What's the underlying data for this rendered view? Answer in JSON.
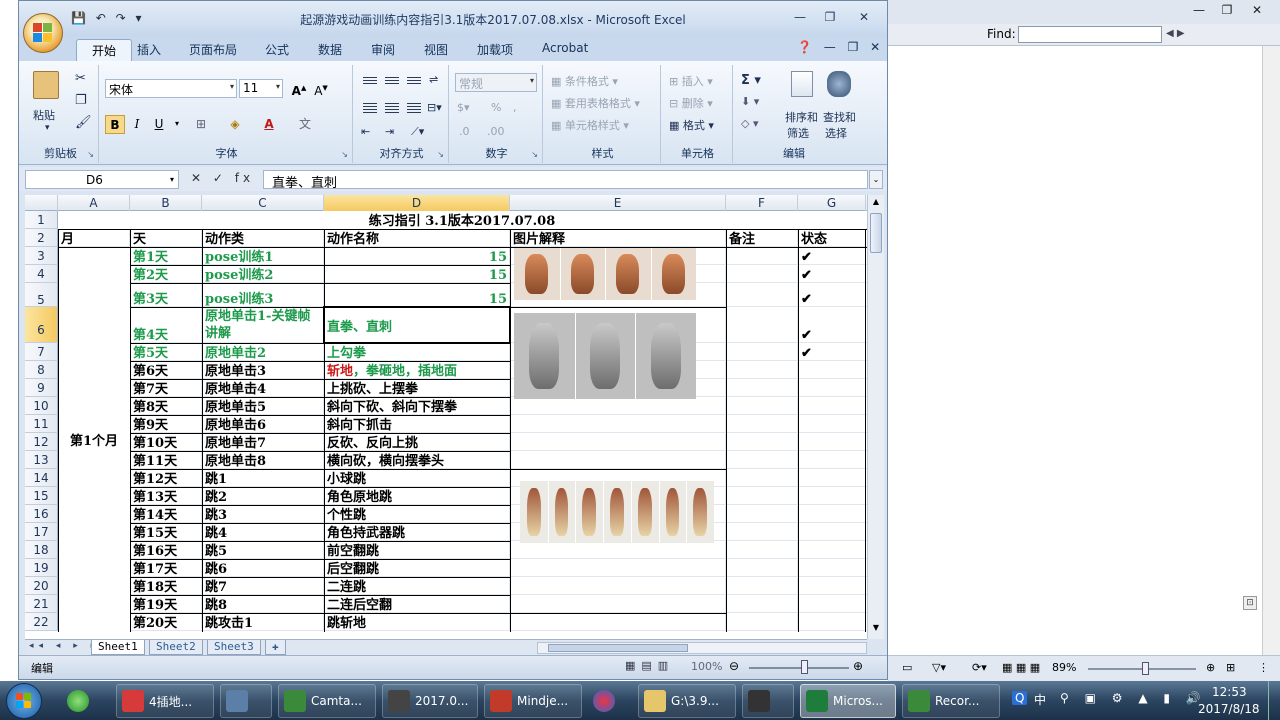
{
  "background_window": {
    "find_label": "Find:",
    "zoom": "89%",
    "window_controls": [
      "—",
      "❐",
      "✕"
    ]
  },
  "title_bar": {
    "title": "起源游戏动画训练内容指引3.1版本2017.07.08.xlsx - Microsoft Excel",
    "quick_access": "💾 ↶ ↷ ▾",
    "controls": [
      "—",
      "❐",
      "✕"
    ]
  },
  "tabs": [
    "开始",
    "插入",
    "页面布局",
    "公式",
    "数据",
    "审阅",
    "视图",
    "加载项",
    "Acrobat"
  ],
  "tabs_right": "❓ — ❐ ✕",
  "ribbon": {
    "clipboard": {
      "label": "剪贴板",
      "paste": "粘贴"
    },
    "font": {
      "label": "字体",
      "name": "宋体",
      "size": "11"
    },
    "alignment": {
      "label": "对齐方式"
    },
    "number": {
      "label": "数字",
      "format": "常规"
    },
    "styles": {
      "label": "样式",
      "conditional": "条件格式",
      "table": "套用表格格式",
      "cell": "单元格样式"
    },
    "cells": {
      "label": "单元格",
      "insert": "插入",
      "delete": "删除",
      "format": "格式"
    },
    "editing": {
      "label": "编辑",
      "sort": "排序和",
      "sort2": "筛选",
      "find": "查找和",
      "find2": "选择"
    }
  },
  "formula_bar": {
    "name_box": "D6",
    "fx": "✕ ✓ fx",
    "content": "直拳、直刺"
  },
  "columns": [
    "A",
    "B",
    "C",
    "D",
    "E",
    "F",
    "G"
  ],
  "rows": [
    "1",
    "2",
    "3",
    "4",
    "5",
    "6",
    "7",
    "8",
    "9",
    "10",
    "11",
    "12",
    "13",
    "14",
    "15",
    "16",
    "17",
    "18",
    "19",
    "20",
    "21",
    "22"
  ],
  "sheet": {
    "title": "练习指引 3.1版本2017.07.08",
    "headers": [
      "月",
      "天",
      "动作类",
      "动作名称",
      "图片解释",
      "备注",
      "状态"
    ],
    "month": "第1个月",
    "data_rows": [
      {
        "day": "第1天",
        "type": "pose训练1",
        "name": "15",
        "status": "✔"
      },
      {
        "day": "第2天",
        "type": "pose训练2",
        "name": "15",
        "status": "✔"
      },
      {
        "day": "第3天",
        "type": "pose训练3",
        "name": "15",
        "status": "✔"
      },
      {
        "day": "第4天",
        "type": "原地单击1-关键帧讲解",
        "name": "直拳、直刺",
        "status": "✔"
      },
      {
        "day": "第5天",
        "type": "原地单击2",
        "name": "上勾拳",
        "status": "✔"
      },
      {
        "day": "第6天",
        "type": "原地单击3",
        "name": "斩地，拳砸地，插地面",
        "status": ""
      },
      {
        "day": "第7天",
        "type": "原地单击4",
        "name": "上挑砍、上摆拳",
        "status": ""
      },
      {
        "day": "第8天",
        "type": "原地单击5",
        "name": "斜向下砍、斜向下摆拳",
        "status": ""
      },
      {
        "day": "第9天",
        "type": "原地单击6",
        "name": "斜向下抓击",
        "status": ""
      },
      {
        "day": "第10天",
        "type": "原地单击7",
        "name": "反砍、反向上挑",
        "status": ""
      },
      {
        "day": "第11天",
        "type": "原地单击8",
        "name": "横向砍，横向摆拳头",
        "status": ""
      },
      {
        "day": "第12天",
        "type": "跳1",
        "name": "小球跳",
        "status": ""
      },
      {
        "day": "第13天",
        "type": "跳2",
        "name": "角色原地跳",
        "status": ""
      },
      {
        "day": "第14天",
        "type": "跳3",
        "name": "个性跳",
        "status": ""
      },
      {
        "day": "第15天",
        "type": "跳4",
        "name": "角色持武器跳",
        "status": ""
      },
      {
        "day": "第16天",
        "type": "跳5",
        "name": "前空翻跳",
        "status": ""
      },
      {
        "day": "第17天",
        "type": "跳6",
        "name": "后空翻跳",
        "status": ""
      },
      {
        "day": "第18天",
        "type": "跳7",
        "name": "二连跳",
        "status": ""
      },
      {
        "day": "第19天",
        "type": "跳8",
        "name": "二连后空翻",
        "status": ""
      },
      {
        "day": "第20天",
        "type": "跳攻击1",
        "name": "跳斩地",
        "status": ""
      }
    ]
  },
  "sheet_tabs": [
    "Sheet1",
    "Sheet2",
    "Sheet3"
  ],
  "status_bar": {
    "mode": "编辑",
    "zoom": "100%"
  },
  "taskbar": {
    "items": [
      "4插地...",
      "",
      "Camta...",
      "2017.0...",
      "Mindje...",
      "",
      "G:\\3.9...",
      "",
      "Micros...",
      "Recor..."
    ],
    "ime": "中",
    "time": "12:53",
    "date": "2017/8/18"
  },
  "colors": {
    "green_text": "#1d9a4c",
    "red_text": "#cc1a1a",
    "ribbon_blue": "#dbe5f1"
  }
}
